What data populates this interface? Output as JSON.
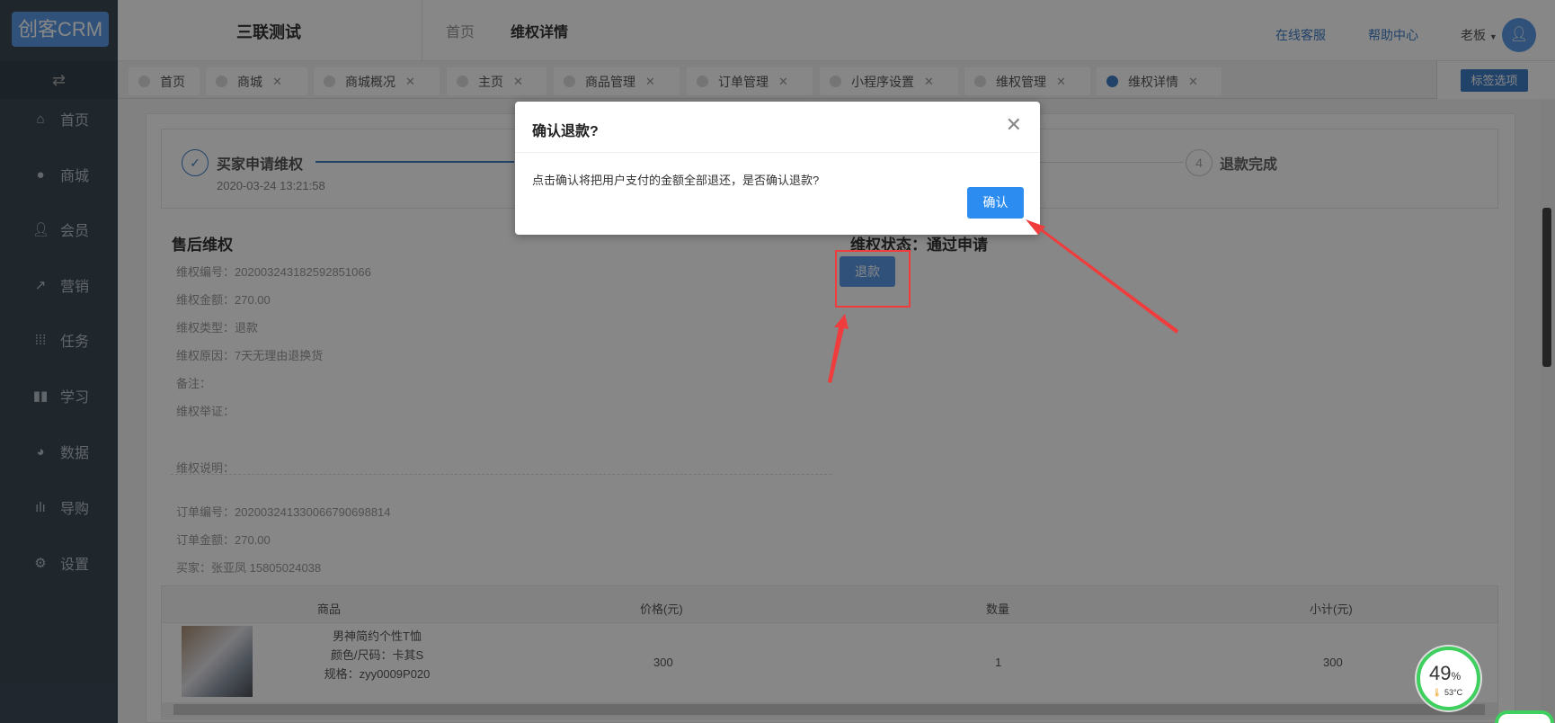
{
  "app": {
    "logo": "创客CRM",
    "toggle_icon": "⇄"
  },
  "sidebar": {
    "items": [
      {
        "label": "首页",
        "icon": "home"
      },
      {
        "label": "商城",
        "icon": "shop"
      },
      {
        "label": "会员",
        "icon": "user"
      },
      {
        "label": "营销",
        "icon": "trend"
      },
      {
        "label": "任务",
        "icon": "grid"
      },
      {
        "label": "学习",
        "icon": "book"
      },
      {
        "label": "数据",
        "icon": "pie"
      },
      {
        "label": "导购",
        "icon": "group"
      },
      {
        "label": "设置",
        "icon": "gear"
      }
    ]
  },
  "header": {
    "store": "三联测试",
    "breadcrumb": [
      "首页",
      "维权详情"
    ],
    "links": [
      "在线客服",
      "帮助中心"
    ],
    "user": "老板"
  },
  "tabs": [
    {
      "label": "首页"
    },
    {
      "label": "商城"
    },
    {
      "label": "商城概况"
    },
    {
      "label": "主页"
    },
    {
      "label": "商品管理"
    },
    {
      "label": "订单管理"
    },
    {
      "label": "小程序设置"
    },
    {
      "label": "维权管理"
    },
    {
      "label": "维权详情",
      "active": true
    }
  ],
  "tab_options": "标签选项",
  "steps": {
    "step1": {
      "title": "买家申请维权",
      "time": "2020-03-24 13:21:58"
    },
    "step4": {
      "num": "4",
      "title": "退款完成"
    }
  },
  "detail": {
    "title": "售后维权",
    "rows": [
      "维权编号：20200324318259285​1066",
      "维权金额：270.00",
      "维权类型：退款",
      "维权原因：7天无理由退换货",
      "备注：",
      "维权举证：",
      "维权说明："
    ],
    "order": [
      "订单编号：20200324133006679069​8814",
      "订单金额：270.00",
      "买家：张亚凤  15805024038"
    ]
  },
  "status": {
    "label": "维权状态：通过申请",
    "refund_button": "退款"
  },
  "table": {
    "headers": [
      "商品",
      "价格(元)",
      "数量",
      "小计(元)"
    ],
    "rows": [
      {
        "name": "男神简约个性T恤",
        "color": "颜色/尺码：卡其S",
        "spec": "规格：zyy0009P020",
        "price": "300",
        "qty": "1",
        "subtotal": "300"
      }
    ]
  },
  "dialog": {
    "title": "确认退款?",
    "message": "点击确认将把用户支付的金额全部退还，是否确认退款?",
    "confirm": "确认"
  },
  "widget": {
    "percent": "49",
    "unit": "%",
    "temp": "53°C"
  }
}
